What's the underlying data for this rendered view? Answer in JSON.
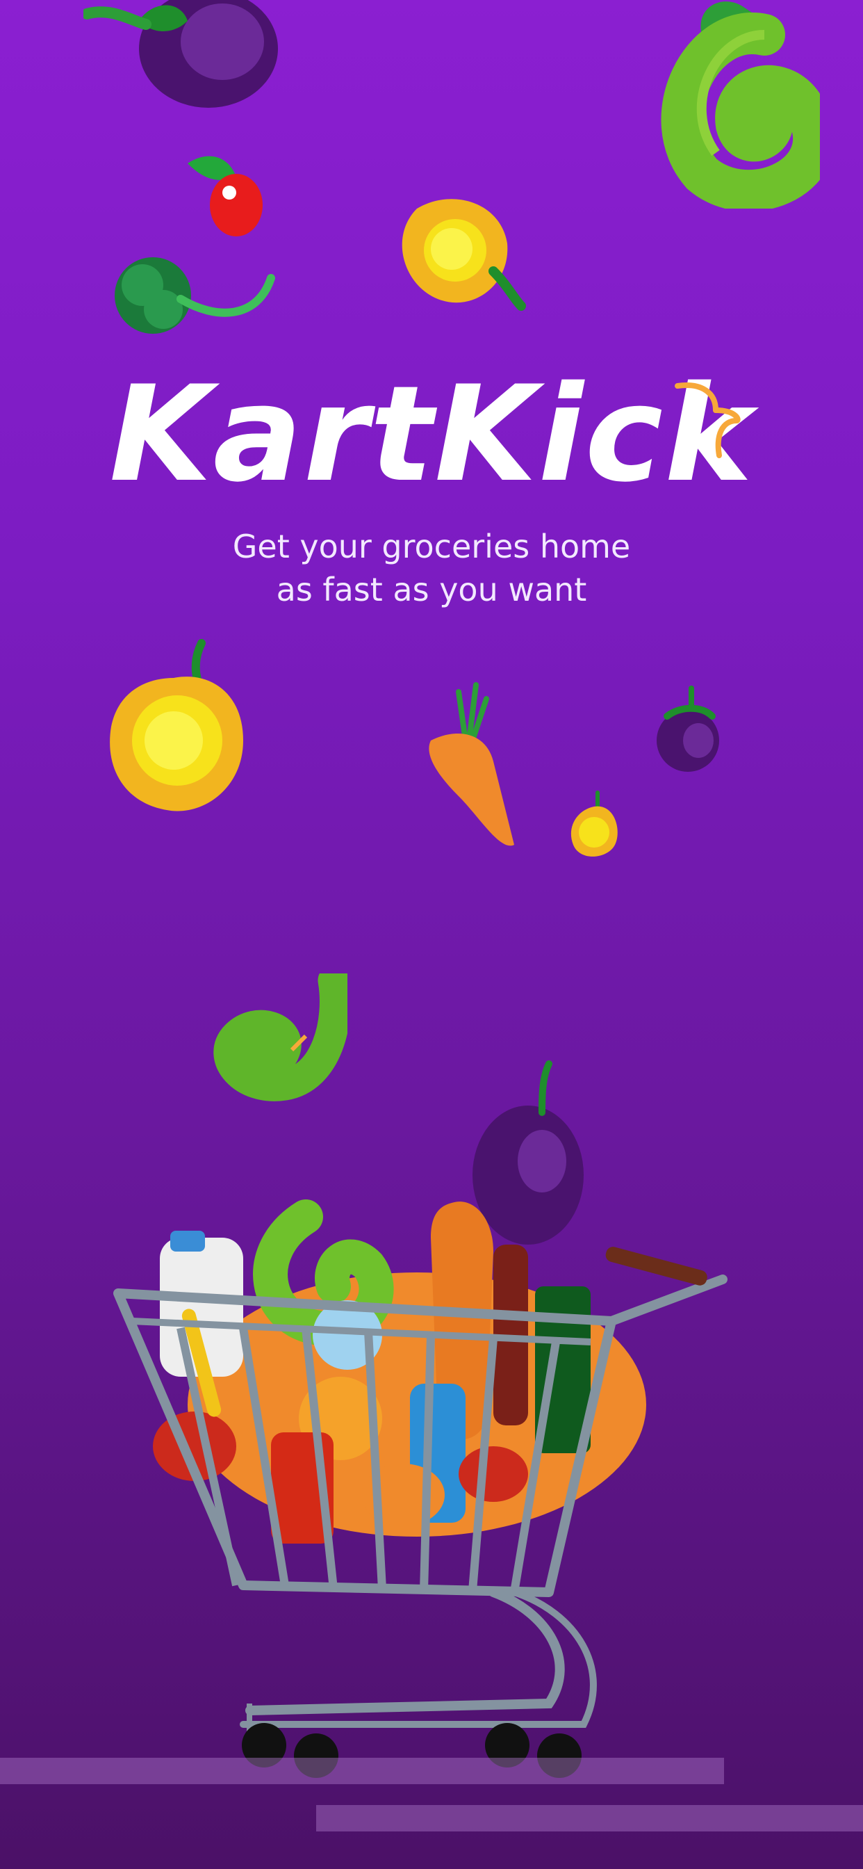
{
  "splash": {
    "app_name": "KartKick",
    "tagline_line1": "Get your groceries home",
    "tagline_line2": "as fast as you want"
  },
  "colors": {
    "background_top": "#8b1fd1",
    "background_bottom": "#4b1167",
    "text": "#ffffff",
    "accent": "#f7a83a"
  },
  "illustrations": [
    "eggplant-icon",
    "green-chili-icon",
    "red-pepper-icon",
    "yellow-pepper-icon",
    "broccoli-icon",
    "carrot-icon",
    "shopping-cart-icon"
  ]
}
